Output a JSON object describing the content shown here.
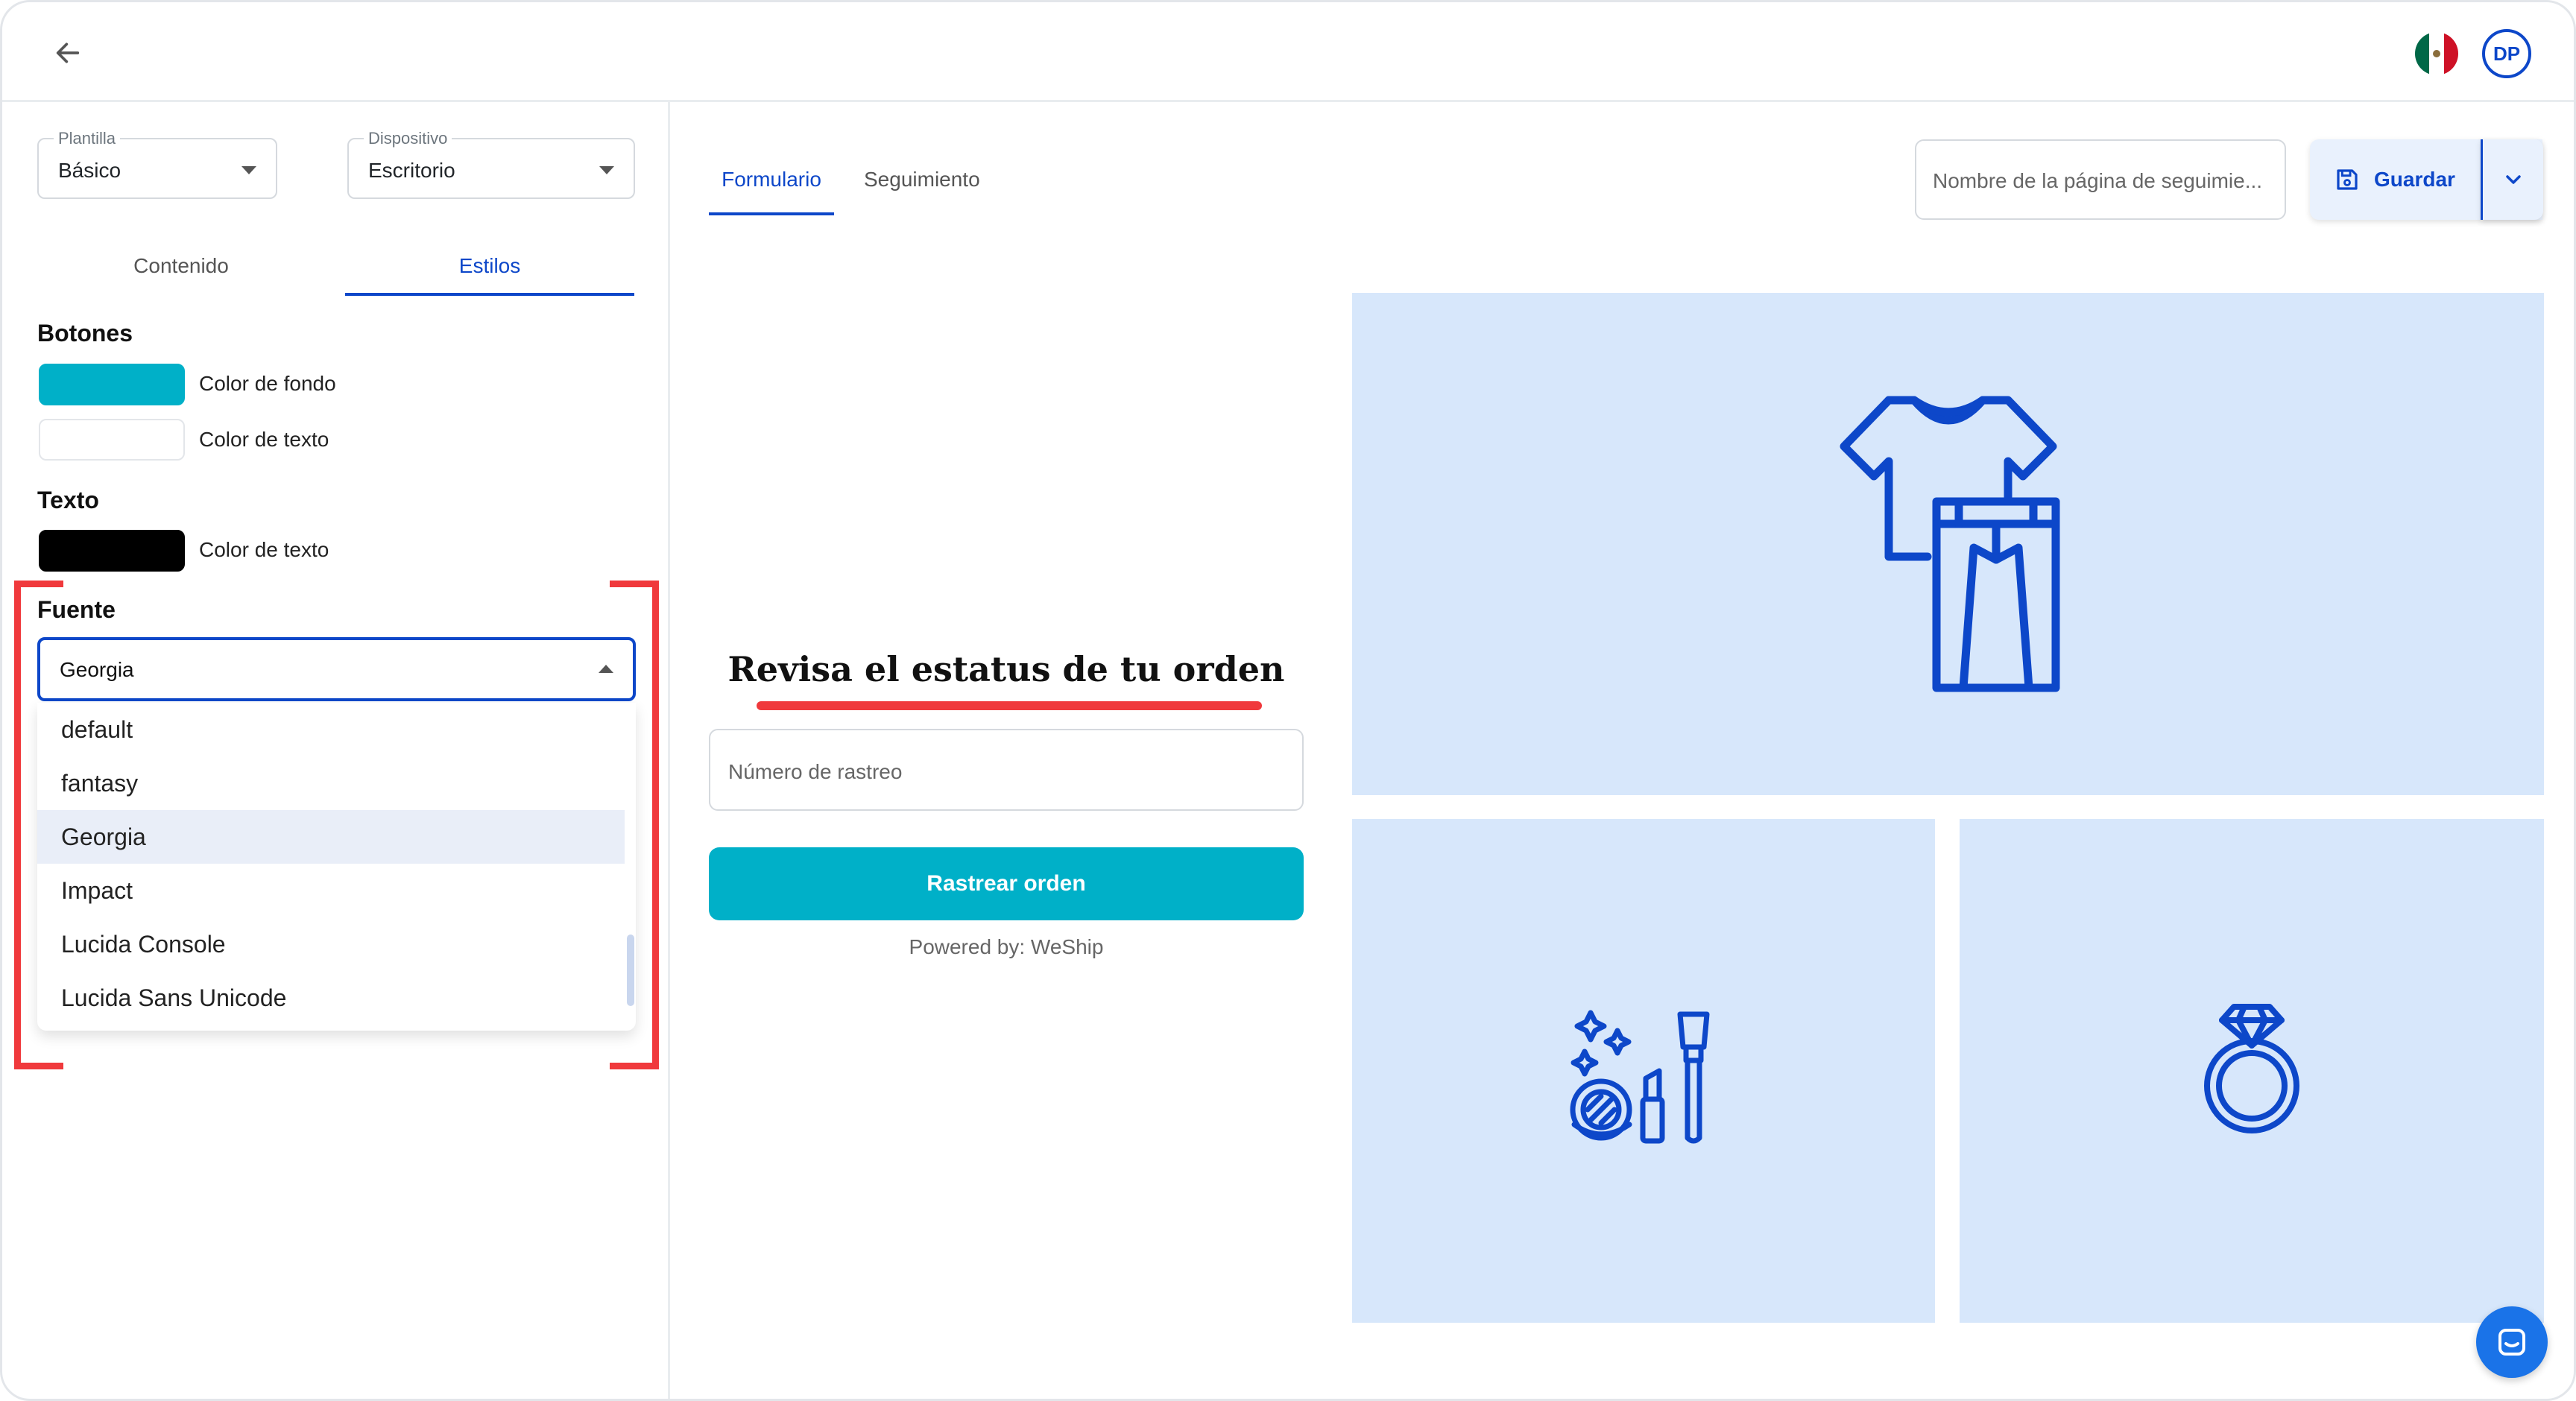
{
  "header": {
    "back_icon": "arrow-left-icon",
    "flag_icon": "mexico-flag-icon",
    "avatar_initials": "DP"
  },
  "sidebar": {
    "template": {
      "label": "Plantilla",
      "value": "Básico"
    },
    "device": {
      "label": "Dispositivo",
      "value": "Escritorio"
    },
    "tabs": [
      {
        "label": "Contenido",
        "active": false
      },
      {
        "label": "Estilos",
        "active": true
      }
    ],
    "buttons_section": {
      "title": "Botones",
      "bg_color": "#00b0c8",
      "bg_label": "Color de fondo",
      "text_color": "#ffffff",
      "text_label": "Color de texto"
    },
    "text_section": {
      "title": "Texto",
      "color": "#000000",
      "label": "Color de texto"
    },
    "font_section": {
      "title": "Fuente",
      "selected": "Georgia",
      "options": [
        "default",
        "fantasy",
        "Georgia",
        "Impact",
        "Lucida Console",
        "Lucida Sans Unicode"
      ]
    }
  },
  "main": {
    "tabs": [
      {
        "label": "Formulario",
        "active": true
      },
      {
        "label": "Seguimiento",
        "active": false
      }
    ],
    "page_name_placeholder": "Nombre de la página de seguimie...",
    "save_label": "Guardar",
    "save_icon": "floppy-disk-icon",
    "form": {
      "title": "Revisa el estatus de tu orden",
      "tracking_placeholder": "Número de rastreo",
      "button_label": "Rastrear orden",
      "powered_by": "Powered by: WeShip"
    },
    "images": [
      "clothing-icon",
      "cosmetics-icon",
      "ring-icon"
    ]
  },
  "colors": {
    "accent": "#0d47c9",
    "button": "#00b0c8",
    "panel_bg": "#d7e7fb",
    "highlight": "#f0393c"
  }
}
